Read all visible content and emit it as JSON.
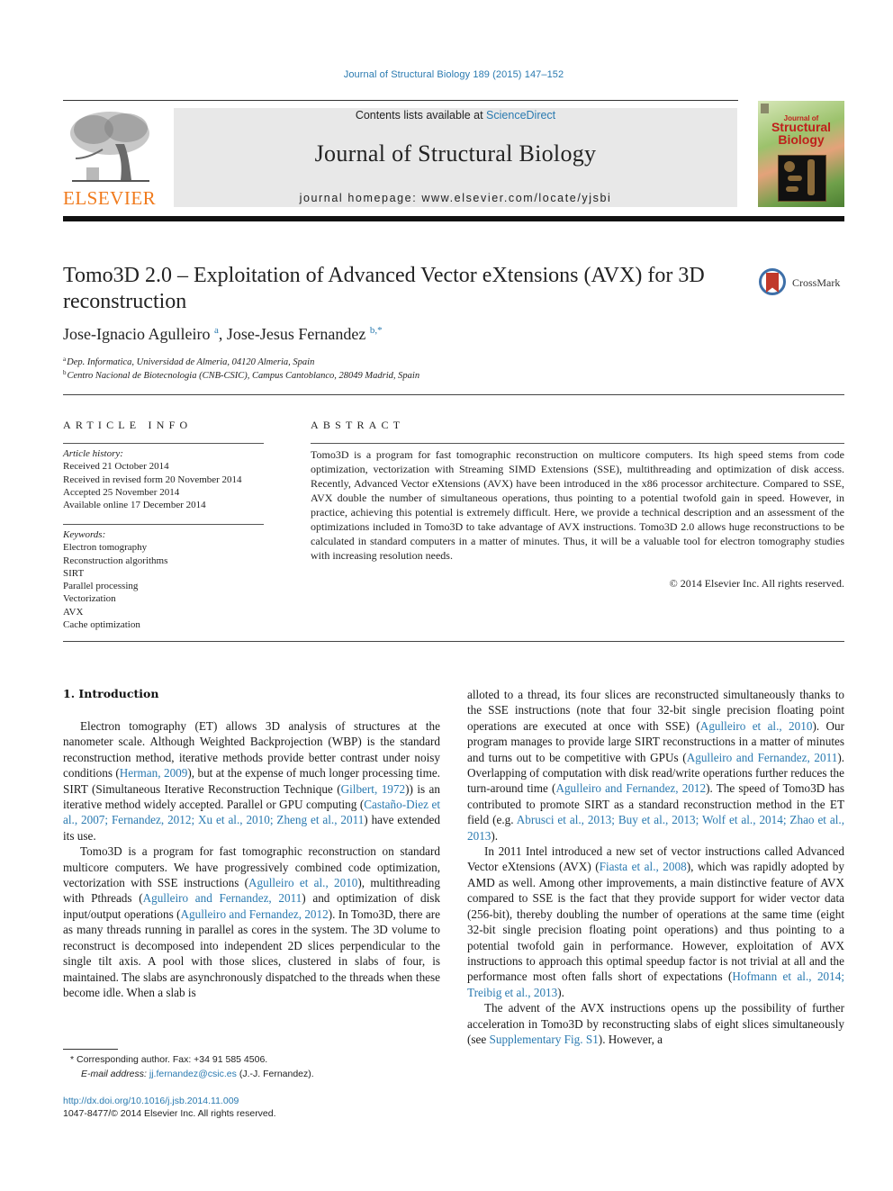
{
  "header": {
    "citation": "Journal of Structural Biology 189 (2015) 147–152",
    "contents_prefix": "Contents lists available at ",
    "contents_link": "ScienceDirect",
    "journal_name": "Journal of Structural Biology",
    "homepage": "journal homepage: www.elsevier.com/locate/yjsbi",
    "publisher_logo": "ELSEVIER",
    "cover": {
      "line1": "Journal of",
      "line2": "Structural",
      "line3": "Biology"
    }
  },
  "article": {
    "title": "Tomo3D 2.0 – Exploitation of Advanced Vector eXtensions (AVX) for 3D reconstruction",
    "crossmark_label": "CrossMark",
    "authors": [
      {
        "name": "Jose-Ignacio Agulleiro",
        "mark": "a"
      },
      {
        "name": "Jose-Jesus Fernandez",
        "mark": "b,*"
      }
    ],
    "author_separator": ", ",
    "affiliations": [
      {
        "mark": "a",
        "text": "Dep. Informatica, Universidad de Almeria, 04120 Almeria, Spain"
      },
      {
        "mark": "b",
        "text": "Centro Nacional de Biotecnologia (CNB-CSIC), Campus Cantoblanco, 28049 Madrid, Spain"
      }
    ]
  },
  "article_info": {
    "heading": "ARTICLE INFO",
    "history_label": "Article history:",
    "history": [
      "Received 21 October 2014",
      "Received in revised form 20 November 2014",
      "Accepted 25 November 2014",
      "Available online 17 December 2014"
    ],
    "keywords_label": "Keywords:",
    "keywords": [
      "Electron tomography",
      "Reconstruction algorithms",
      "SIRT",
      "Parallel processing",
      "Vectorization",
      "AVX",
      "Cache optimization"
    ]
  },
  "abstract": {
    "heading": "ABSTRACT",
    "text": "Tomo3D is a program for fast tomographic reconstruction on multicore computers. Its high speed stems from code optimization, vectorization with Streaming SIMD Extensions (SSE), multithreading and optimization of disk access. Recently, Advanced Vector eXtensions (AVX) have been introduced in the x86 processor architecture. Compared to SSE, AVX double the number of simultaneous operations, thus pointing to a potential twofold gain in speed. However, in practice, achieving this potential is extremely difficult. Here, we provide a technical description and an assessment of the optimizations included in Tomo3D to take advantage of AVX instructions. Tomo3D 2.0 allows huge reconstructions to be calculated in standard computers in a matter of minutes. Thus, it will be a valuable tool for electron tomography studies with increasing resolution needs.",
    "copyright": "© 2014 Elsevier Inc. All rights reserved."
  },
  "body": {
    "section_title": "1. Introduction",
    "paragraphs": [
      {
        "column": "left",
        "continued": false,
        "segments": [
          {
            "t": "Electron tomography (ET) allows 3D analysis of structures at the nanometer scale. Although Weighted Backprojection (WBP) is the standard reconstruction method, iterative methods provide better contrast under noisy conditions ("
          },
          {
            "t": "Herman, 2009",
            "link": true
          },
          {
            "t": "), but at the expense of much longer processing time. SIRT (Simultaneous Iterative Reconstruction Technique ("
          },
          {
            "t": "Gilbert, 1972",
            "link": true
          },
          {
            "t": ")) is an iterative method widely accepted. Parallel or GPU computing ("
          },
          {
            "t": "Castaño-Diez et al., 2007; Fernandez, 2012; Xu et al., 2010; Zheng et al., 2011",
            "link": true
          },
          {
            "t": ") have extended its use."
          }
        ]
      },
      {
        "column": "left",
        "continued": false,
        "segments": [
          {
            "t": "Tomo3D is a program for fast tomographic reconstruction on standard multicore computers. We have progressively combined code optimization, vectorization with SSE instructions ("
          },
          {
            "t": "Agulleiro et al., 2010",
            "link": true
          },
          {
            "t": "), multithreading with Pthreads ("
          },
          {
            "t": "Agulleiro and Fernandez, 2011",
            "link": true
          },
          {
            "t": ") and optimization of disk input/output operations ("
          },
          {
            "t": "Agulleiro and Fernandez, 2012",
            "link": true
          },
          {
            "t": "). In Tomo3D, there are as many threads running in parallel as cores in the system. The 3D volume to reconstruct is decomposed into independent 2D slices perpendicular to the single tilt axis. A pool with those slices, clustered in slabs of four, is maintained. The slabs are asynchronously dispatched to the threads when these become idle. When a slab is"
          }
        ]
      },
      {
        "column": "right",
        "continued": true,
        "segments": [
          {
            "t": "alloted to a thread, its four slices are reconstructed simultaneously thanks to the SSE instructions (note that four 32-bit single precision floating point operations are executed at once with SSE) ("
          },
          {
            "t": "Agulleiro et al., 2010",
            "link": true
          },
          {
            "t": "). Our program manages to provide large SIRT reconstructions in a matter of minutes and turns out to be competitive with GPUs ("
          },
          {
            "t": "Agulleiro and Fernandez, 2011",
            "link": true
          },
          {
            "t": "). Overlapping of computation with disk read/write operations further reduces the turn-around time ("
          },
          {
            "t": "Agulleiro and Fernandez, 2012",
            "link": true
          },
          {
            "t": "). The speed of Tomo3D has contributed to promote SIRT as a standard reconstruction method in the ET field (e.g. "
          },
          {
            "t": "Abrusci et al., 2013; Buy et al., 2013; Wolf et al., 2014; Zhao et al., 2013",
            "link": true
          },
          {
            "t": ")."
          }
        ]
      },
      {
        "column": "right",
        "continued": false,
        "segments": [
          {
            "t": "In 2011 Intel introduced a new set of vector instructions called Advanced Vector eXtensions (AVX) ("
          },
          {
            "t": "Fiasta et al., 2008",
            "link": true
          },
          {
            "t": "), which was rapidly adopted by AMD as well. Among other improvements, a main distinctive feature of AVX compared to SSE is the fact that they provide support for wider vector data (256-bit), thereby doubling the number of operations at the same time (eight 32-bit single precision floating point operations) and thus pointing to a potential twofold gain in performance. However, exploitation of AVX instructions to approach this optimal speedup factor is not trivial at all and the performance most often falls short of expectations ("
          },
          {
            "t": "Hofmann et al., 2014; Treibig et al., 2013",
            "link": true
          },
          {
            "t": ")."
          }
        ]
      },
      {
        "column": "right",
        "continued": false,
        "segments": [
          {
            "t": "The advent of the AVX instructions opens up the possibility of further acceleration in Tomo3D by reconstructing slabs of eight slices simultaneously (see "
          },
          {
            "t": "Supplementary Fig. S1",
            "link": true
          },
          {
            "t": "). However, a"
          }
        ]
      }
    ]
  },
  "footnotes": {
    "corresponding": "Corresponding author. Fax: +34 91 585 4506.",
    "corresponding_mark": "*",
    "email_label": "E-mail address: ",
    "email": "jj.fernandez@csic.es",
    "email_suffix": " (J.-J. Fernandez).",
    "doi": "http://dx.doi.org/10.1016/j.jsb.2014.11.009",
    "issn": "1047-8477/© 2014 Elsevier Inc. All rights reserved."
  },
  "colors": {
    "link": "#2a7ab0",
    "elsevier_orange": "#f07a1c",
    "masthead_bg": "#e8e8e8",
    "cover_title_red": "#c0201c"
  }
}
